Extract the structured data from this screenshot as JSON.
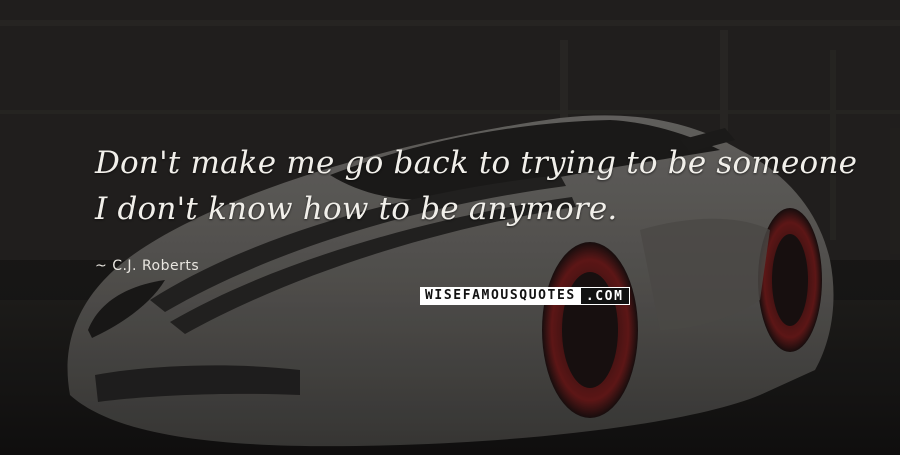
{
  "quote": {
    "text": "Don't make me go back to trying to be someone I don't know how to be anymore.",
    "author": "C.J. Roberts"
  },
  "watermark": {
    "part_a": "WISEFAMOUSQUOTES",
    "part_b": ".COM"
  },
  "background": {
    "subject": "white sports car with red wheels",
    "colors": {
      "car_body": "#d9d7d3",
      "wheel_rim": "#8a1f1f",
      "stripe": "#2a2a2a",
      "backdrop": "#1d1c1a"
    }
  }
}
